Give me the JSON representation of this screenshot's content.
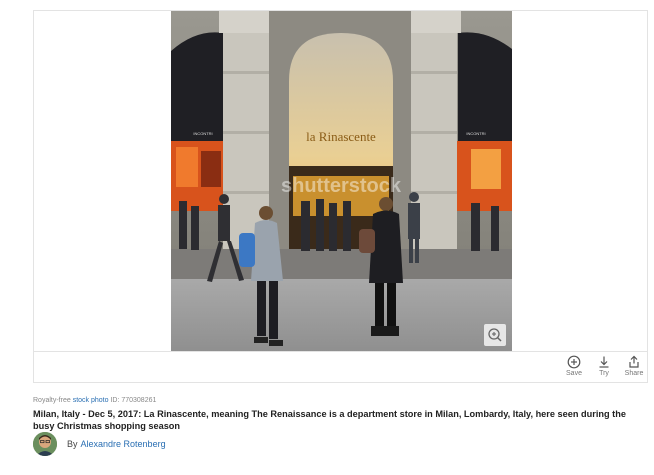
{
  "photo": {
    "storefront_name": "la Rinascente",
    "store_side_sign": "INCONTRI",
    "watermark": "shutterstock",
    "zoom_icon": "zoom-in-icon"
  },
  "actions": [
    {
      "label": "Save",
      "icon": "plus-circle-icon"
    },
    {
      "label": "Try",
      "icon": "download-icon"
    },
    {
      "label": "Share",
      "icon": "share-icon"
    }
  ],
  "meta": {
    "prefix": "Royalty-free",
    "link_text": "stock photo",
    "id_text": "ID: 770308261",
    "description": "Milan, Italy - Dec 5, 2017: La Rinascente, meaning The Renaissance is a department store in Milan, Lombardy, Italy, here seen during the busy Christmas shopping season"
  },
  "author": {
    "by_label": "By",
    "name": "Alexandre Rotenberg"
  },
  "colors": {
    "link": "#2a6fb3",
    "border": "#e3e3e3",
    "storefront_glow": "#f0c060",
    "window_orange": "#e0501a"
  }
}
